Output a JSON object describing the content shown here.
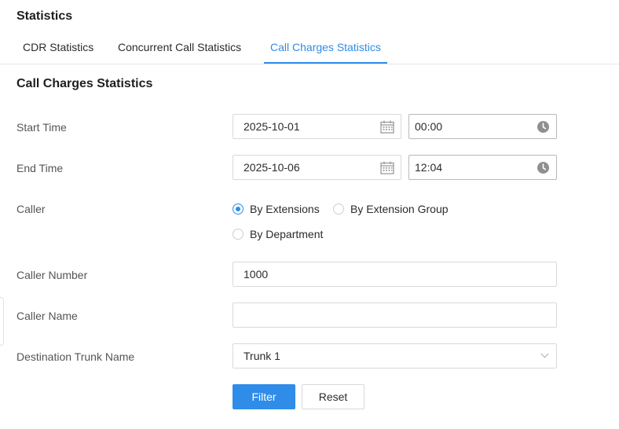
{
  "page": {
    "title": "Statistics"
  },
  "tabs": [
    {
      "label": "CDR Statistics",
      "active": false
    },
    {
      "label": "Concurrent Call Statistics",
      "active": false
    },
    {
      "label": "Call Charges Statistics",
      "active": true
    }
  ],
  "section": {
    "title": "Call Charges Statistics"
  },
  "form": {
    "start_time": {
      "label": "Start Time",
      "date": "2025-10-01",
      "time": "00:00"
    },
    "end_time": {
      "label": "End Time",
      "date": "2025-10-06",
      "time": "12:04"
    },
    "caller": {
      "label": "Caller",
      "options": [
        "By Extensions",
        "By Extension Group",
        "By Department"
      ],
      "selected": "By Extensions"
    },
    "caller_number": {
      "label": "Caller Number",
      "value": "1000"
    },
    "caller_name": {
      "label": "Caller Name",
      "value": ""
    },
    "destination_trunk": {
      "label": "Destination Trunk Name",
      "value": "Trunk 1"
    }
  },
  "buttons": {
    "filter": "Filter",
    "reset": "Reset"
  },
  "icons": {
    "date": "calendar-icon",
    "time": "clock-icon",
    "select": "chevron-down-icon"
  },
  "colors": {
    "accent": "#2f8ce8",
    "border": "#d9d9d9",
    "label": "#555555"
  }
}
